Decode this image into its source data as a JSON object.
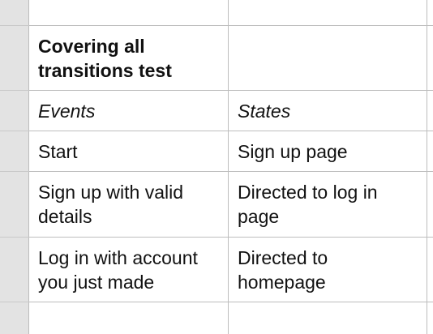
{
  "sheet": {
    "title_cell": "Covering all\ntransitions test",
    "headers": {
      "events": "Events",
      "states": "States"
    },
    "rows": [
      {
        "event": "Start",
        "state": "Sign up page"
      },
      {
        "event": "Sign up with valid\ndetails",
        "state": "Directed to log in\npage"
      },
      {
        "event": "Log in with account\nyou just made",
        "state": "Directed to\nhomepage"
      }
    ]
  }
}
